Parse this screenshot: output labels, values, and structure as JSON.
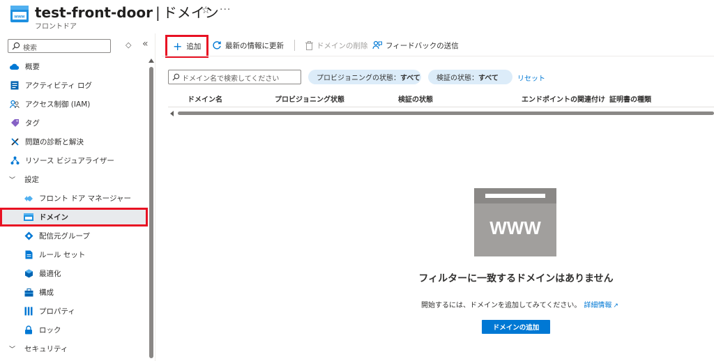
{
  "header": {
    "resource_name": "test-front-door",
    "separator": "|",
    "page_name": "ドメイン",
    "subtitle": "フロントドア",
    "favorite_icon": "star-icon",
    "more_icon": "ellipsis-icon"
  },
  "sidebar": {
    "search_placeholder": "検索",
    "items": [
      {
        "label": "概要",
        "icon": "cloud-icon",
        "level": 0
      },
      {
        "label": "アクティビティ ログ",
        "icon": "activity-log-icon",
        "level": 0
      },
      {
        "label": "アクセス制御 (IAM)",
        "icon": "people-icon",
        "level": 0
      },
      {
        "label": "タグ",
        "icon": "tag-icon",
        "level": 0
      },
      {
        "label": "問題の診断と解決",
        "icon": "wrench-icon",
        "level": 0
      },
      {
        "label": "リソース ビジュアライザー",
        "icon": "visualizer-icon",
        "level": 0
      },
      {
        "label": "設定",
        "icon": "chevron-down-icon",
        "level": "section"
      },
      {
        "label": "フロント ドア マネージャー",
        "icon": "front-door-manager-icon",
        "level": 1
      },
      {
        "label": "ドメイン",
        "icon": "domain-icon",
        "level": 1,
        "active": true
      },
      {
        "label": "配信元グループ",
        "icon": "origin-group-icon",
        "level": 1
      },
      {
        "label": "ルール セット",
        "icon": "rule-set-icon",
        "level": 1
      },
      {
        "label": "最適化",
        "icon": "optimize-icon",
        "level": 1
      },
      {
        "label": "構成",
        "icon": "configuration-icon",
        "level": 1
      },
      {
        "label": "プロパティ",
        "icon": "properties-icon",
        "level": 1
      },
      {
        "label": "ロック",
        "icon": "lock-icon",
        "level": 1
      },
      {
        "label": "セキュリティ",
        "icon": "chevron-down-icon",
        "level": "section"
      }
    ]
  },
  "toolbar": {
    "add_label": "追加",
    "refresh_label": "最新の情報に更新",
    "delete_label": "ドメインの削除",
    "feedback_label": "フィードバックの送信"
  },
  "filters": {
    "search_placeholder": "ドメイン名で検索してください",
    "provisioning_label": "プロビジョニングの状態：",
    "provisioning_value": "すべて",
    "validation_label": "検証の状態：",
    "validation_value": "すべて",
    "reset_label": "リセット"
  },
  "table": {
    "columns": [
      "ドメイン名",
      "プロビジョニング状態",
      "検証の状態",
      "エンドポイントの関連付け",
      "証明書の種類"
    ]
  },
  "empty_state": {
    "illustration_text": "WWW",
    "title": "フィルターに一致するドメインはありません",
    "description": "開始するには、ドメインを追加してみてください。",
    "link_label": "詳細情報",
    "cta_label": "ドメインの追加"
  },
  "colors": {
    "accent": "#0078d4",
    "highlight_border": "#e81123",
    "pill_bg": "#dcecf9"
  }
}
